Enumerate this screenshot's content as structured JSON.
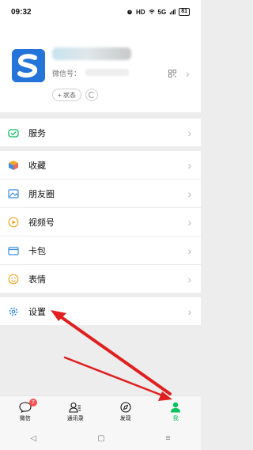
{
  "status_bar": {
    "time": "09:32",
    "hd": "HD",
    "signal": "5G",
    "battery": "81"
  },
  "profile": {
    "wxid_label": "微信号：",
    "status_button": "+ 状态"
  },
  "menu": {
    "services": "服务",
    "favorites": "收藏",
    "moments": "朋友圈",
    "channels": "视频号",
    "wallet": "卡包",
    "stickers": "表情",
    "settings": "设置"
  },
  "tabbar": {
    "chats": "微信",
    "chats_badge": "7",
    "contacts": "通讯录",
    "discover": "发现",
    "me": "我"
  },
  "colors": {
    "accent": "#07c160",
    "badge": "#fa5151",
    "arrow": "#e02020",
    "avatar": "#2574d9"
  }
}
